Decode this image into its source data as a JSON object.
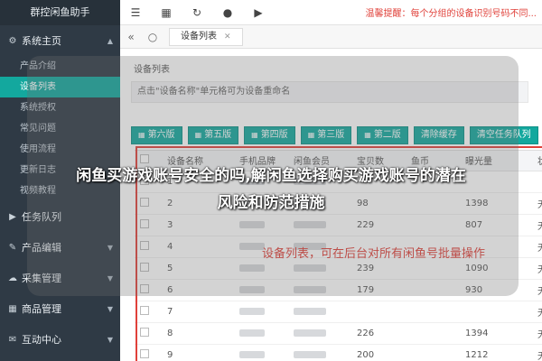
{
  "app": {
    "title": "群控闲鱼助手"
  },
  "topbar": {
    "icons": [
      "list-icon",
      "grid-icon",
      "refresh-icon",
      "chat-icon",
      "play-icon"
    ],
    "notice": "温馨提醒：每个分组的设备识别号码不同..."
  },
  "tabs": {
    "back_symbol": "«",
    "items": [
      {
        "label": "设备列表"
      }
    ]
  },
  "sidebar": {
    "groups": [
      {
        "label": "系统主页",
        "icon": "gear-icon",
        "expanded": true,
        "children": [
          {
            "label": "产品介绍"
          },
          {
            "label": "设备列表",
            "active": true
          },
          {
            "label": "系统授权"
          },
          {
            "label": "常见问题"
          },
          {
            "label": "使用流程"
          },
          {
            "label": "更新日志"
          },
          {
            "label": "视频教程"
          }
        ]
      },
      {
        "label": "任务队列",
        "icon": "play-icon"
      },
      {
        "label": "产品编辑",
        "icon": "edit-icon"
      },
      {
        "label": "采集管理",
        "icon": "collect-icon"
      },
      {
        "label": "商品管理",
        "icon": "goods-icon"
      },
      {
        "label": "互动中心",
        "icon": "chat-icon"
      }
    ]
  },
  "page": {
    "breadcrumb": "设备列表",
    "hint": "点击\"设备名称\"单元格可为设备重命名",
    "buttons": [
      {
        "label": "第六版"
      },
      {
        "label": "第五版"
      },
      {
        "label": "第四版"
      },
      {
        "label": "第三版"
      },
      {
        "label": "第二版"
      },
      {
        "label": "清除缓存"
      },
      {
        "label": "清空任务队列"
      }
    ]
  },
  "table": {
    "columns": [
      "设备名称",
      "手机品牌",
      "闲鱼会员",
      "宝贝数",
      "鱼币",
      "曝光量",
      "状态"
    ],
    "rows": [
      {
        "name": "1",
        "count": "",
        "fish": "",
        "views": "",
        "status": ""
      },
      {
        "name": "2",
        "count": "98",
        "fish": "",
        "views": "1398",
        "status": "无"
      },
      {
        "name": "3",
        "count": "229",
        "fish": "",
        "views": "807",
        "status": "无"
      },
      {
        "name": "4",
        "count": "",
        "fish": "",
        "views": "",
        "status": "无"
      },
      {
        "name": "5",
        "count": "239",
        "fish": "",
        "views": "1090",
        "status": "无"
      },
      {
        "name": "6",
        "count": "179",
        "fish": "",
        "views": "930",
        "status": "无"
      },
      {
        "name": "7",
        "count": "",
        "fish": "",
        "views": "",
        "status": "无"
      },
      {
        "name": "8",
        "count": "226",
        "fish": "",
        "views": "1394",
        "status": "无"
      },
      {
        "name": "9",
        "count": "200",
        "fish": "",
        "views": "1212",
        "status": "无"
      }
    ]
  },
  "annotation": {
    "caption": "设备列表，可在后台对所有闲鱼号批量操作"
  },
  "headline": {
    "line1": "闲鱼买游戏账号安全的吗,解闲鱼选择购买游戏账号的潜在",
    "line2": "风险和防范措施"
  },
  "colors": {
    "sidebar_bg": "#2f3a45",
    "accent": "#13a89e",
    "alert": "#e0413a"
  }
}
